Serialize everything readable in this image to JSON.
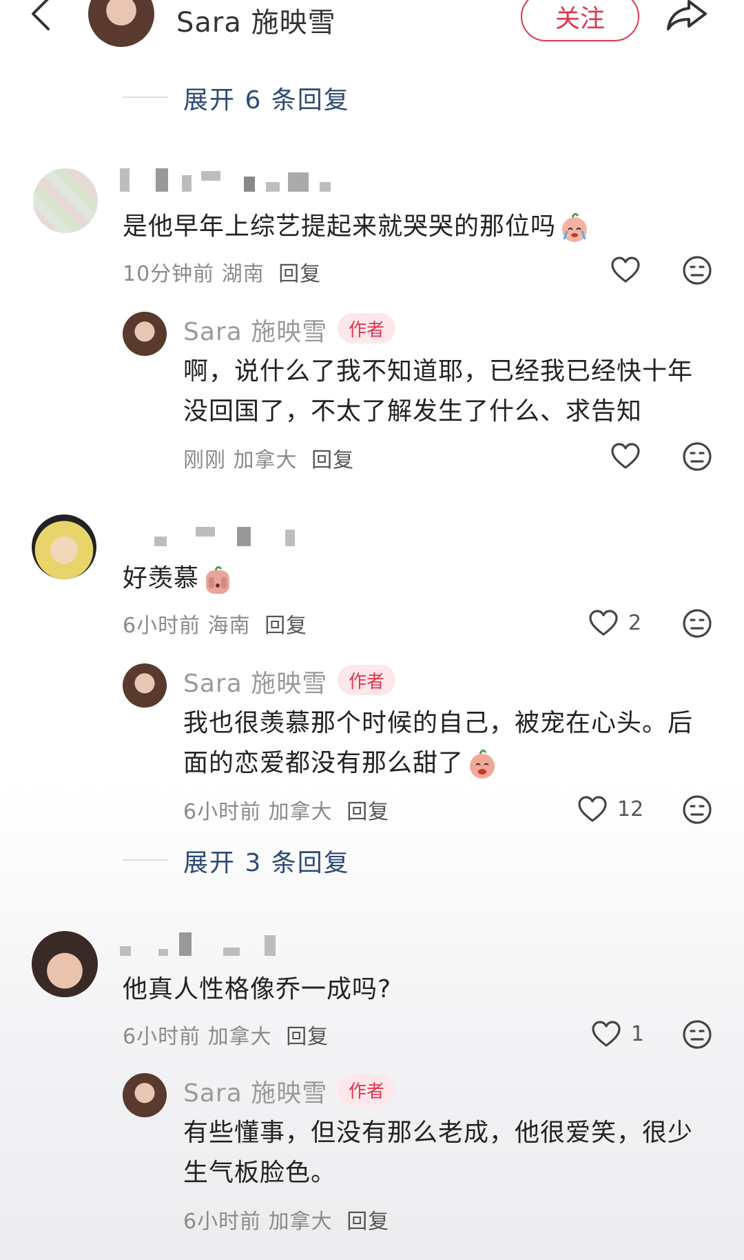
{
  "header": {
    "author_name": "Sara 施映雪",
    "follow_label": "关注"
  },
  "expand_top": "展开 6 条回复",
  "comments": [
    {
      "text": "是他早年上综艺提起来就哭哭的那位吗",
      "time": "10分钟前",
      "location": "湖南",
      "reply_label": "回复",
      "likes": "",
      "reply": {
        "author": "Sara 施映雪",
        "tag": "作者",
        "text": "啊，说什么了我不知道耶，已经我已经快十年没回国了，不太了解发生了什么、求告知",
        "time": "刚刚",
        "location": "加拿大",
        "reply_label": "回复",
        "likes": ""
      }
    },
    {
      "text": "好羡慕",
      "time": "6小时前",
      "location": "海南",
      "reply_label": "回复",
      "likes": "2",
      "reply": {
        "author": "Sara 施映雪",
        "tag": "作者",
        "text": "我也很羡慕那个时候的自己，被宠在心头。后面的恋爱都没有那么甜了",
        "time": "6小时前",
        "location": "加拿大",
        "reply_label": "回复",
        "likes": "12"
      }
    },
    {
      "text": "他真人性格像乔一成吗?",
      "time": "6小时前",
      "location": "加拿大",
      "reply_label": "回复",
      "likes": "1",
      "reply": {
        "author": "Sara 施映雪",
        "tag": "作者",
        "text": "有些懂事，但没有那么老成，他很爱笑，很少生气板脸色。",
        "time": "6小时前",
        "location": "加拿大",
        "reply_label": "回复",
        "likes": ""
      }
    }
  ],
  "expand_mid": "展开 3 条回复",
  "colors": {
    "accent": "#e0364f",
    "expand": "#2e4a73",
    "meta": "#8a8a8a"
  },
  "icons": [
    "back-icon",
    "share-icon",
    "heart-icon",
    "dislike-face-icon",
    "crying-emoji-icon",
    "shy-emoji-icon",
    "pouting-emoji-icon"
  ]
}
